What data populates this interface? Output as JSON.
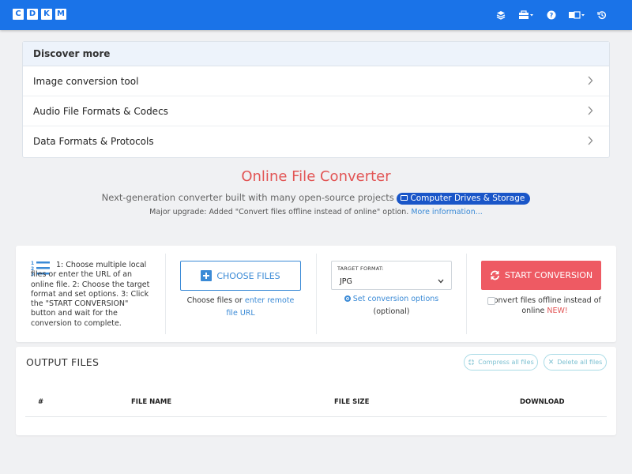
{
  "header": {
    "logo_letters": [
      "C",
      "D",
      "K",
      "M"
    ],
    "icons": [
      "layers-icon",
      "toolbox-icon",
      "help-icon",
      "language-icon",
      "history-icon"
    ]
  },
  "discover": {
    "title": "Discover more",
    "items": [
      {
        "label": "Image conversion tool"
      },
      {
        "label": "Audio File Formats & Codecs"
      },
      {
        "label": "Data Formats & Protocols"
      }
    ]
  },
  "hero": {
    "title": "Online File Converter",
    "subtitle": "Next-generation converter built with many open-source projects",
    "badge": "Computer Drives & Storage",
    "note": "Major upgrade: Added \"Convert files offline instead of online\" option.",
    "note_link": "More information..."
  },
  "converter": {
    "steps": "1: Choose multiple local files or enter the URL of an online file. 2: Choose the target format and set options. 3: Click the \"START CONVERSION\" button and wait for the conversion to complete.",
    "choose_files": "CHOOSE FILES",
    "choose_note_prefix": "Choose files or",
    "choose_note_link": "enter remote file URL",
    "target_label": "TARGET FORMAT:",
    "target_value": "JPG",
    "set_options": "Set conversion options",
    "optional": "(optional)",
    "start": "START CONVERSION",
    "offline_label": "Convert files offline instead of online",
    "offline_new": "NEW!"
  },
  "output": {
    "title": "OUTPUT FILES",
    "compress": "Compress all files",
    "delete": "Delete all files",
    "columns": [
      "#",
      "FILE NAME",
      "FILE SIZE",
      "DOWNLOAD"
    ]
  },
  "colors": {
    "primary": "#1a73e8",
    "accent_red": "#ee5a63",
    "link": "#3a8ad6"
  }
}
